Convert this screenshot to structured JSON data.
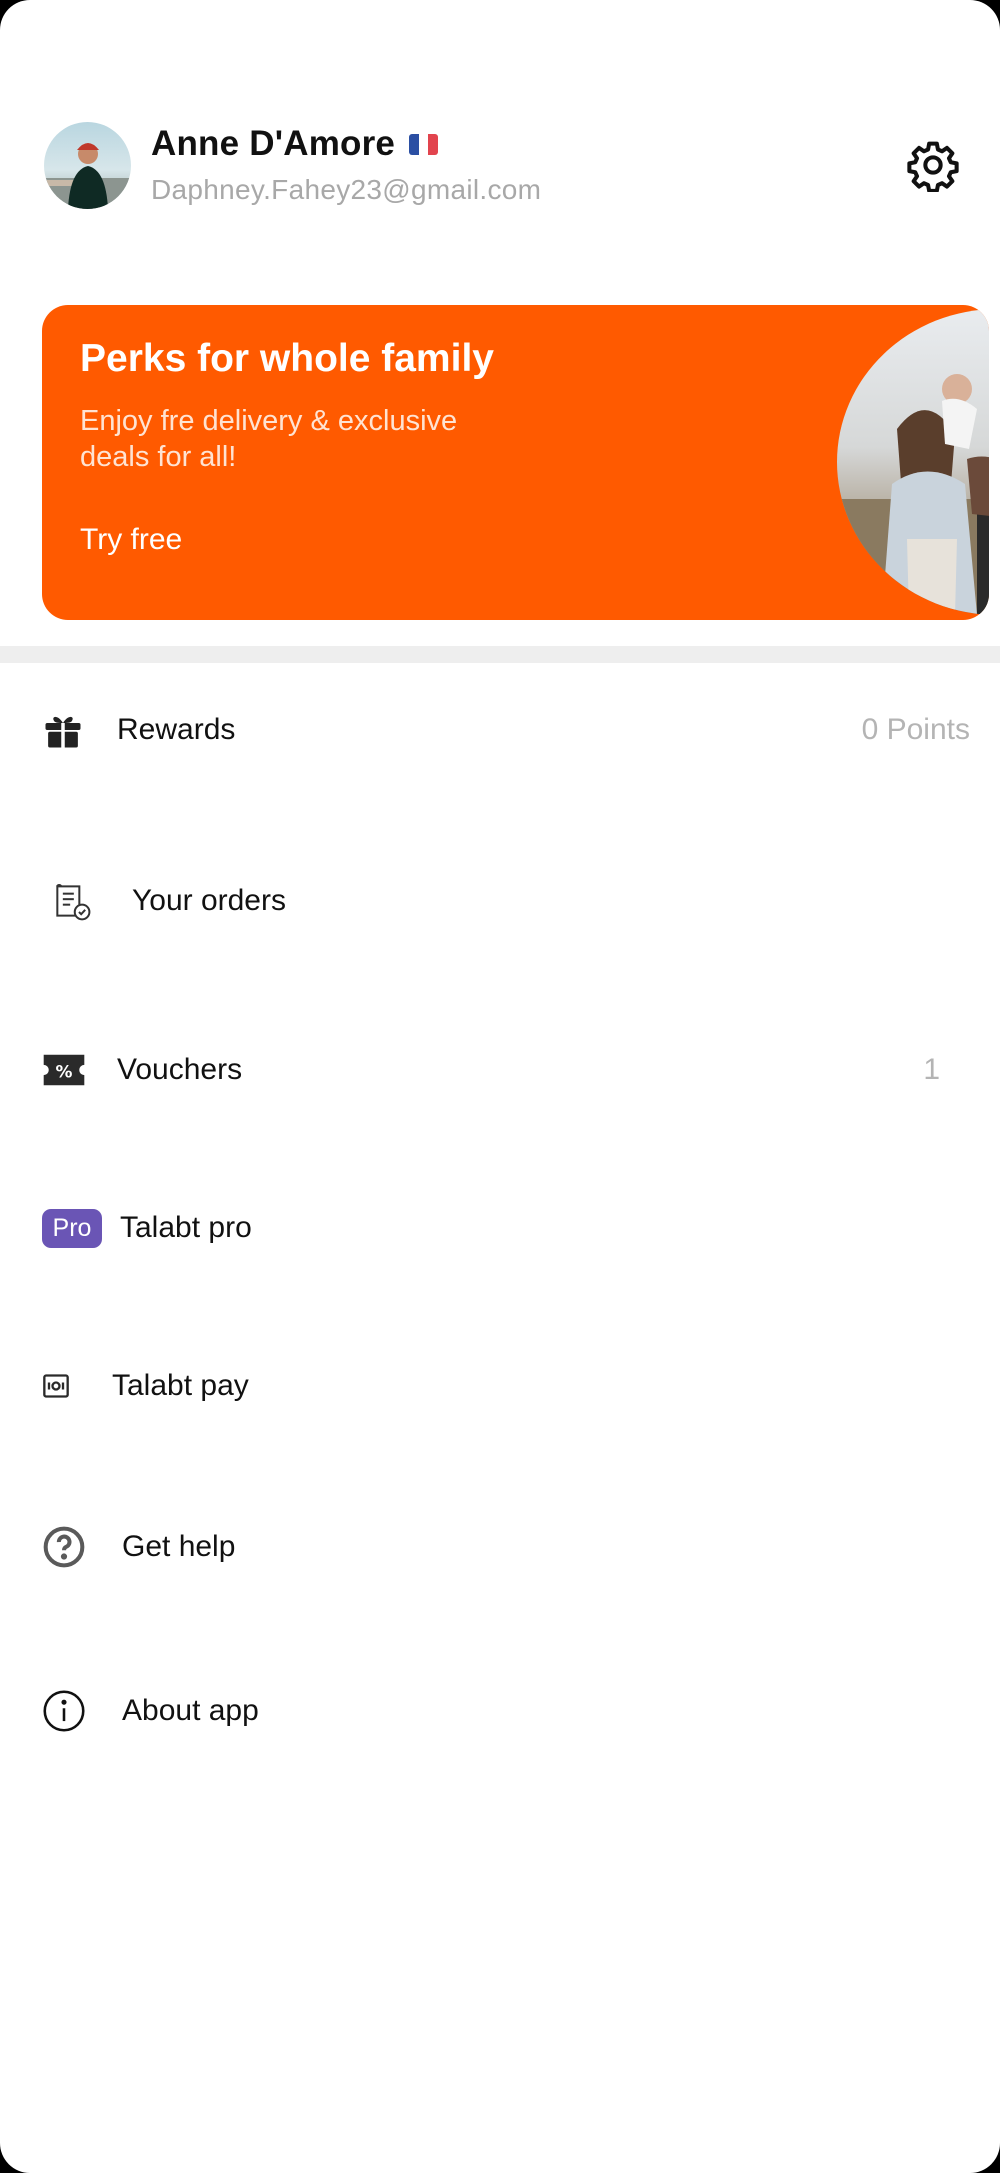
{
  "profile": {
    "name": "Anne D'Amore",
    "email": "Daphney.Fahey23@gmail.com",
    "flag_icon": "france-flag-icon",
    "settings_icon": "gear-icon"
  },
  "banner": {
    "title": "Perks for whole family",
    "subtitle": "Enjoy fre delivery & exclusive deals for all!",
    "cta": "Try free",
    "color": "#ff5a00"
  },
  "menu": {
    "items": [
      {
        "label": "Rewards",
        "value": "0 Points",
        "icon": "gift-icon"
      },
      {
        "label": "Your orders",
        "value": "",
        "icon": "receipt-check-icon"
      },
      {
        "label": "Vouchers",
        "value": "1",
        "icon": "voucher-percent-icon"
      },
      {
        "label": "Talabt pro",
        "value": "",
        "icon": "pro-badge-icon",
        "badge": "Pro"
      },
      {
        "label": "Talabt pay",
        "value": "",
        "icon": "wallet-icon"
      },
      {
        "label": "Get help",
        "value": "",
        "icon": "help-circle-icon"
      },
      {
        "label": "About app",
        "value": "",
        "icon": "info-circle-icon"
      }
    ]
  },
  "colors": {
    "accent": "#ff5a00",
    "pro": "#6a55b5",
    "muted": "#a8a8a8"
  }
}
